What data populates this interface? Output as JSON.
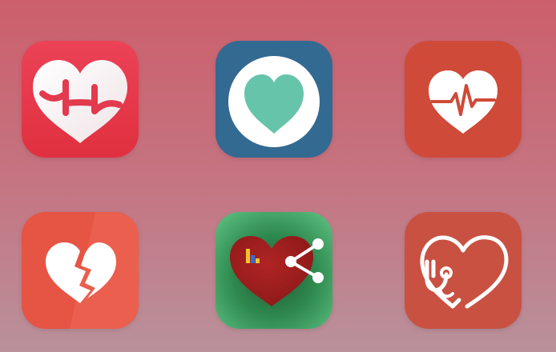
{
  "screen": {
    "background_top": "#cc5f6b",
    "background_bottom": "#b9919b"
  },
  "apps": [
    {
      "icon": "heart-rate-logo-icon",
      "tile_color": "#e63b4e",
      "accent": "#ffffff"
    },
    {
      "icon": "teal-heart-circle-icon",
      "tile_color": "#336a92",
      "accent": "#66c4aa"
    },
    {
      "icon": "heartbeat-pulse-icon",
      "tile_color": "#cf4a38",
      "accent": "#ffffff"
    },
    {
      "icon": "broken-heart-icon",
      "tile_color": "#e65444",
      "accent": "#ffffff"
    },
    {
      "icon": "heart-share-chart-icon",
      "tile_color": "#3b9a5d",
      "accent": "#9e2020"
    },
    {
      "icon": "stethoscope-heart-icon",
      "tile_color": "#c95142",
      "accent": "#ffffff"
    }
  ]
}
